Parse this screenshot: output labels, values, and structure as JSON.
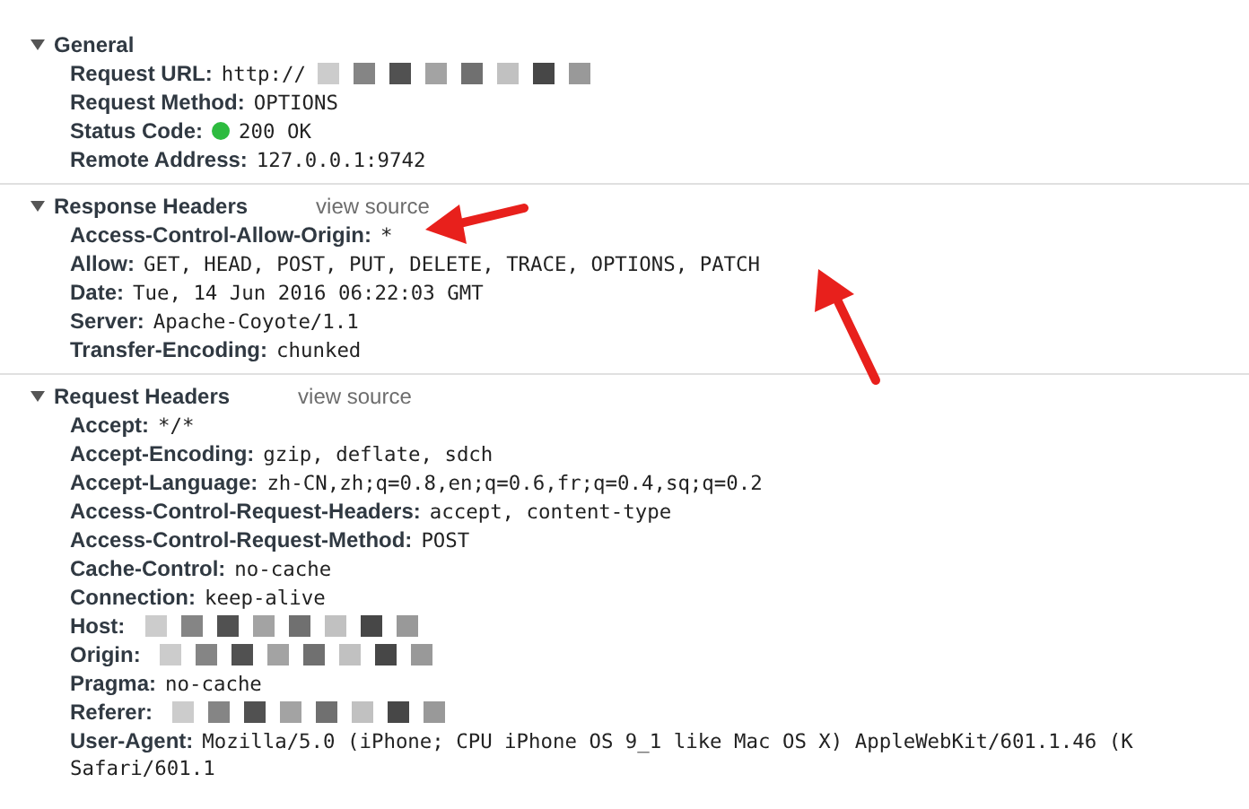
{
  "sections": [
    {
      "title": "General",
      "expanded": true,
      "headers": [
        {
          "name": "Request URL:",
          "value": "http://",
          "redacted": true
        },
        {
          "name": "Request Method:",
          "value": "OPTIONS"
        },
        {
          "name": "Status Code:",
          "value": "200 OK",
          "color": "#2dbb3f"
        },
        {
          "name": "Remote Address:",
          "value": "127.0.0.1:9742"
        }
      ]
    },
    {
      "title": "Response Headers",
      "expanded": true,
      "link": "view source",
      "headers": [
        {
          "name": "Access-Control-Allow-Origin:",
          "value": "*"
        },
        {
          "name": "Allow:",
          "value": "GET, HEAD, POST, PUT, DELETE, TRACE, OPTIONS, PATCH"
        },
        {
          "name": "Date:",
          "value": "Tue, 14 Jun 2016 06:22:03 GMT"
        },
        {
          "name": "Server:",
          "value": "Apache-Coyote/1.1"
        },
        {
          "name": "Transfer-Encoding:",
          "value": "chunked"
        }
      ]
    },
    {
      "title": "Request Headers",
      "expanded": true,
      "link": "view source",
      "headers": [
        {
          "name": "Accept:",
          "value": "*/*"
        },
        {
          "name": "Accept-Encoding:",
          "value": "gzip, deflate, sdch"
        },
        {
          "name": "Accept-Language:",
          "value": "zh-CN,zh;q=0.8,en;q=0.6,fr;q=0.4,sq;q=0.2"
        },
        {
          "name": "Access-Control-Request-Headers:",
          "value": "accept, content-type"
        },
        {
          "name": "Access-Control-Request-Method:",
          "value": "POST"
        },
        {
          "name": "Cache-Control:",
          "value": "no-cache"
        },
        {
          "name": "Connection:",
          "value": "keep-alive"
        },
        {
          "name": "Host:",
          "redacted": true
        },
        {
          "name": "Origin:",
          "redacted": true
        },
        {
          "name": "Pragma:",
          "value": "no-cache"
        },
        {
          "name": "Referer:",
          "redacted": true
        },
        {
          "name": "User-Agent:",
          "value": "Mozilla/5.0 (iPhone; CPU iPhone OS 9_1 like Mac OS X) AppleWebKit/601.1.46 (K",
          "continuation": "Safari/601.1"
        }
      ]
    }
  ]
}
